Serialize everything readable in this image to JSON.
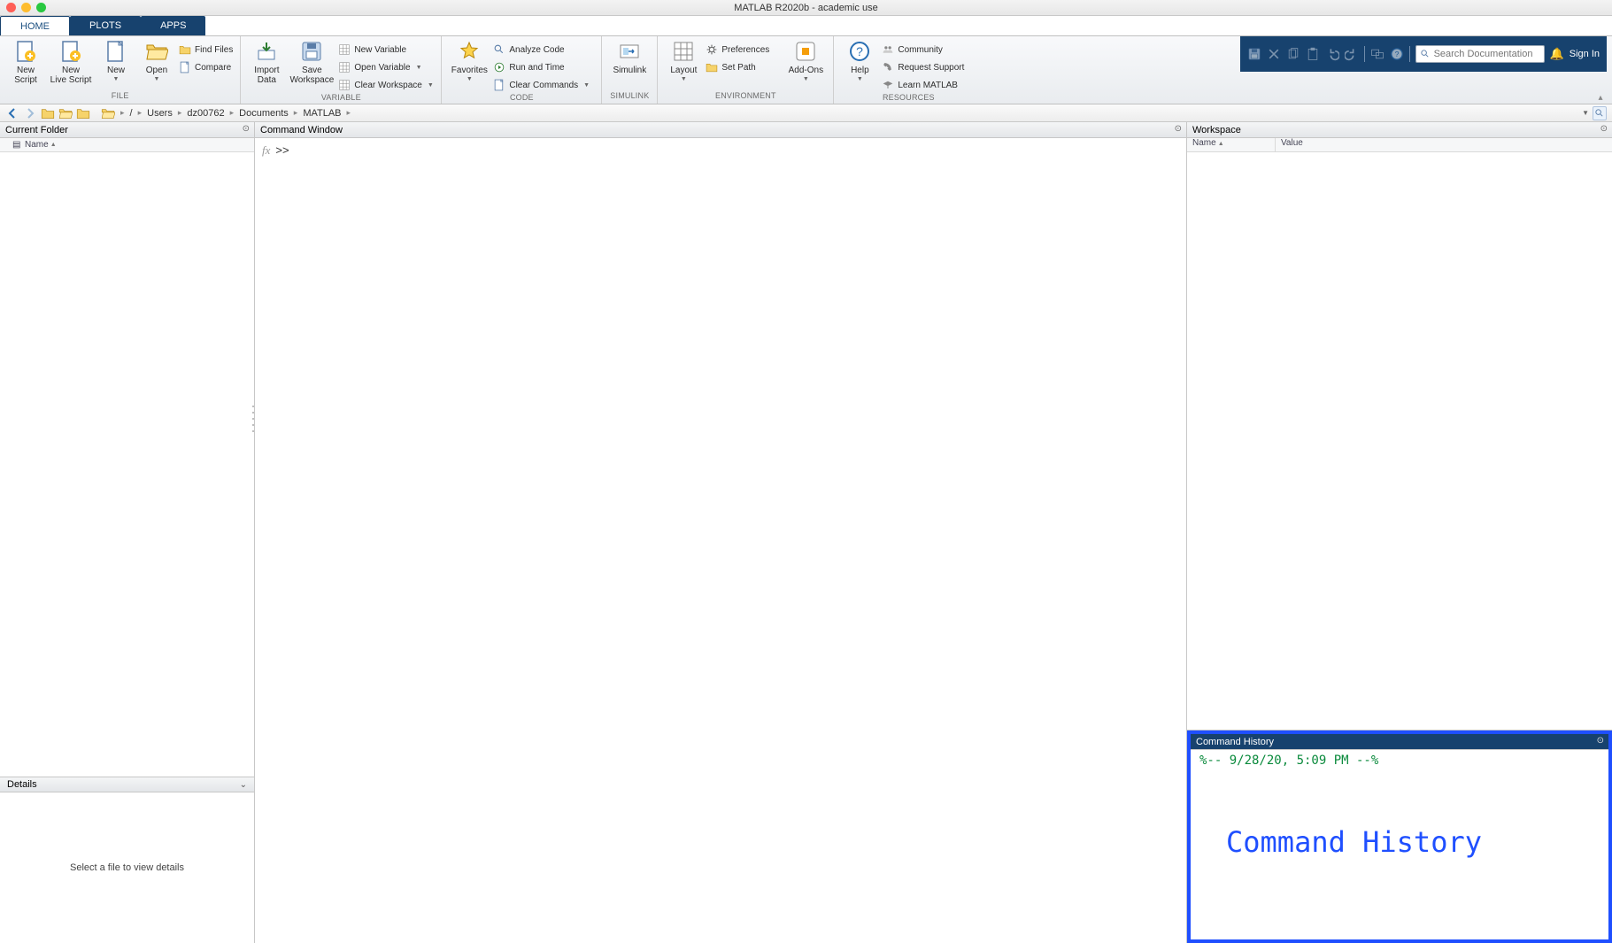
{
  "window": {
    "title": "MATLAB R2020b - academic use"
  },
  "tabs": {
    "home": "HOME",
    "plots": "PLOTS",
    "apps": "APPS"
  },
  "toolstrip": {
    "file": {
      "label": "FILE",
      "newScript": "New\nScript",
      "newLiveScript": "New\nLive Script",
      "new": "New",
      "open": "Open",
      "findFiles": "Find Files",
      "compare": "Compare"
    },
    "variable": {
      "label": "VARIABLE",
      "importData": "Import\nData",
      "saveWorkspace": "Save\nWorkspace",
      "newVariable": "New Variable",
      "openVariable": "Open Variable",
      "clearWorkspace": "Clear Workspace"
    },
    "code": {
      "label": "CODE",
      "favorites": "Favorites",
      "analyzeCode": "Analyze Code",
      "runAndTime": "Run and Time",
      "clearCommands": "Clear Commands"
    },
    "simulink": {
      "label": "SIMULINK",
      "simulink": "Simulink"
    },
    "environment": {
      "label": "ENVIRONMENT",
      "layout": "Layout",
      "preferences": "Preferences",
      "setPath": "Set Path",
      "addons": "Add-Ons"
    },
    "resources": {
      "label": "RESOURCES",
      "help": "Help",
      "community": "Community",
      "requestSupport": "Request Support",
      "learnMatlab": "Learn MATLAB"
    }
  },
  "quickAccess": {
    "searchPlaceholder": "Search Documentation",
    "signIn": "Sign In"
  },
  "address": {
    "crumbs": [
      "/",
      "Users",
      "dz00762",
      "Documents",
      "MATLAB"
    ]
  },
  "panels": {
    "currentFolder": {
      "title": "Current Folder",
      "nameHeader": "Name",
      "detailsTitle": "Details",
      "detailsHint": "Select a file to view details"
    },
    "commandWindow": {
      "title": "Command Window",
      "prompt": ">>"
    },
    "workspace": {
      "title": "Workspace",
      "nameHeader": "Name",
      "valueHeader": "Value"
    },
    "commandHistory": {
      "title": "Command History",
      "timestampComment": "%-- 9/28/20, 5:09 PM --%",
      "overlayLabel": "Command History"
    }
  }
}
